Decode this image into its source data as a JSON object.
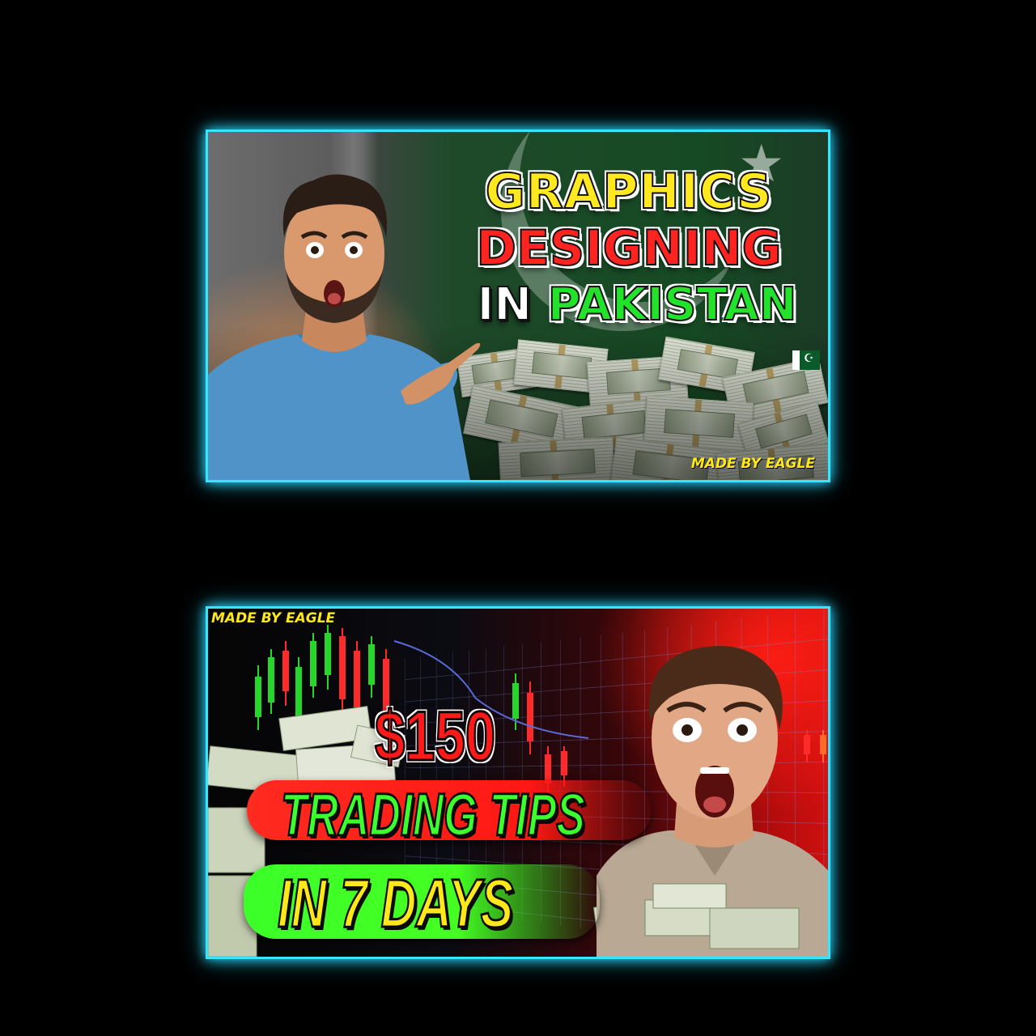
{
  "thumbnails": [
    {
      "title_line1": "GRAPHICS",
      "title_line2": "DESIGNING",
      "title_line3_word1": "IN",
      "title_line3_word2": "PAKISTAN",
      "credit": "MADE BY EAGLE",
      "colors": {
        "border": "#36e6ff",
        "line1": "#ffe81f",
        "line2": "#ff2420",
        "line3_word2": "#23e22c",
        "credit": "#ffe817"
      }
    },
    {
      "price": "$150",
      "line2": "TRADING TIPS",
      "line3": "IN 7 DAYS",
      "credit": "MADE BY EAGLE",
      "colors": {
        "border": "#36e6ff",
        "price": "#ff1a1a",
        "line2": "#3dff2e",
        "line3": "#ffe81a",
        "pill_red": "#ff2a20",
        "pill_green": "#45ff22"
      }
    }
  ]
}
